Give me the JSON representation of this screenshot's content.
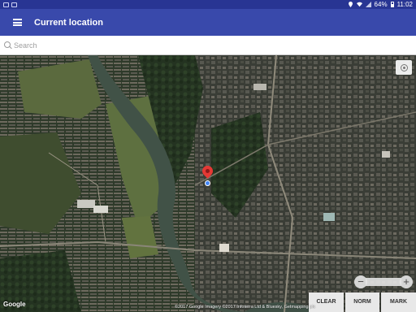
{
  "status_bar": {
    "battery": "64%",
    "time": "11:02"
  },
  "app_bar": {
    "title": "Current location",
    "menu_icon": "hamburger-menu-icon"
  },
  "search": {
    "placeholder": "Search",
    "value": ""
  },
  "map": {
    "type": "satellite",
    "logo": "Google",
    "attribution": "©2017 Google Imagery ©2017 Infoterra Ltd & Bluesky, Getmapping plc",
    "compass_icon": "locate-icon"
  },
  "zoom": {
    "minus": "−",
    "plus": "+"
  },
  "buttons": {
    "clear": "CLEAR",
    "norm": "NORM",
    "mark": "MARK"
  },
  "colors": {
    "status_bar": "#283593",
    "app_bar": "#3949ab",
    "pin": "#e53935",
    "location_dot": "#4285f4"
  }
}
